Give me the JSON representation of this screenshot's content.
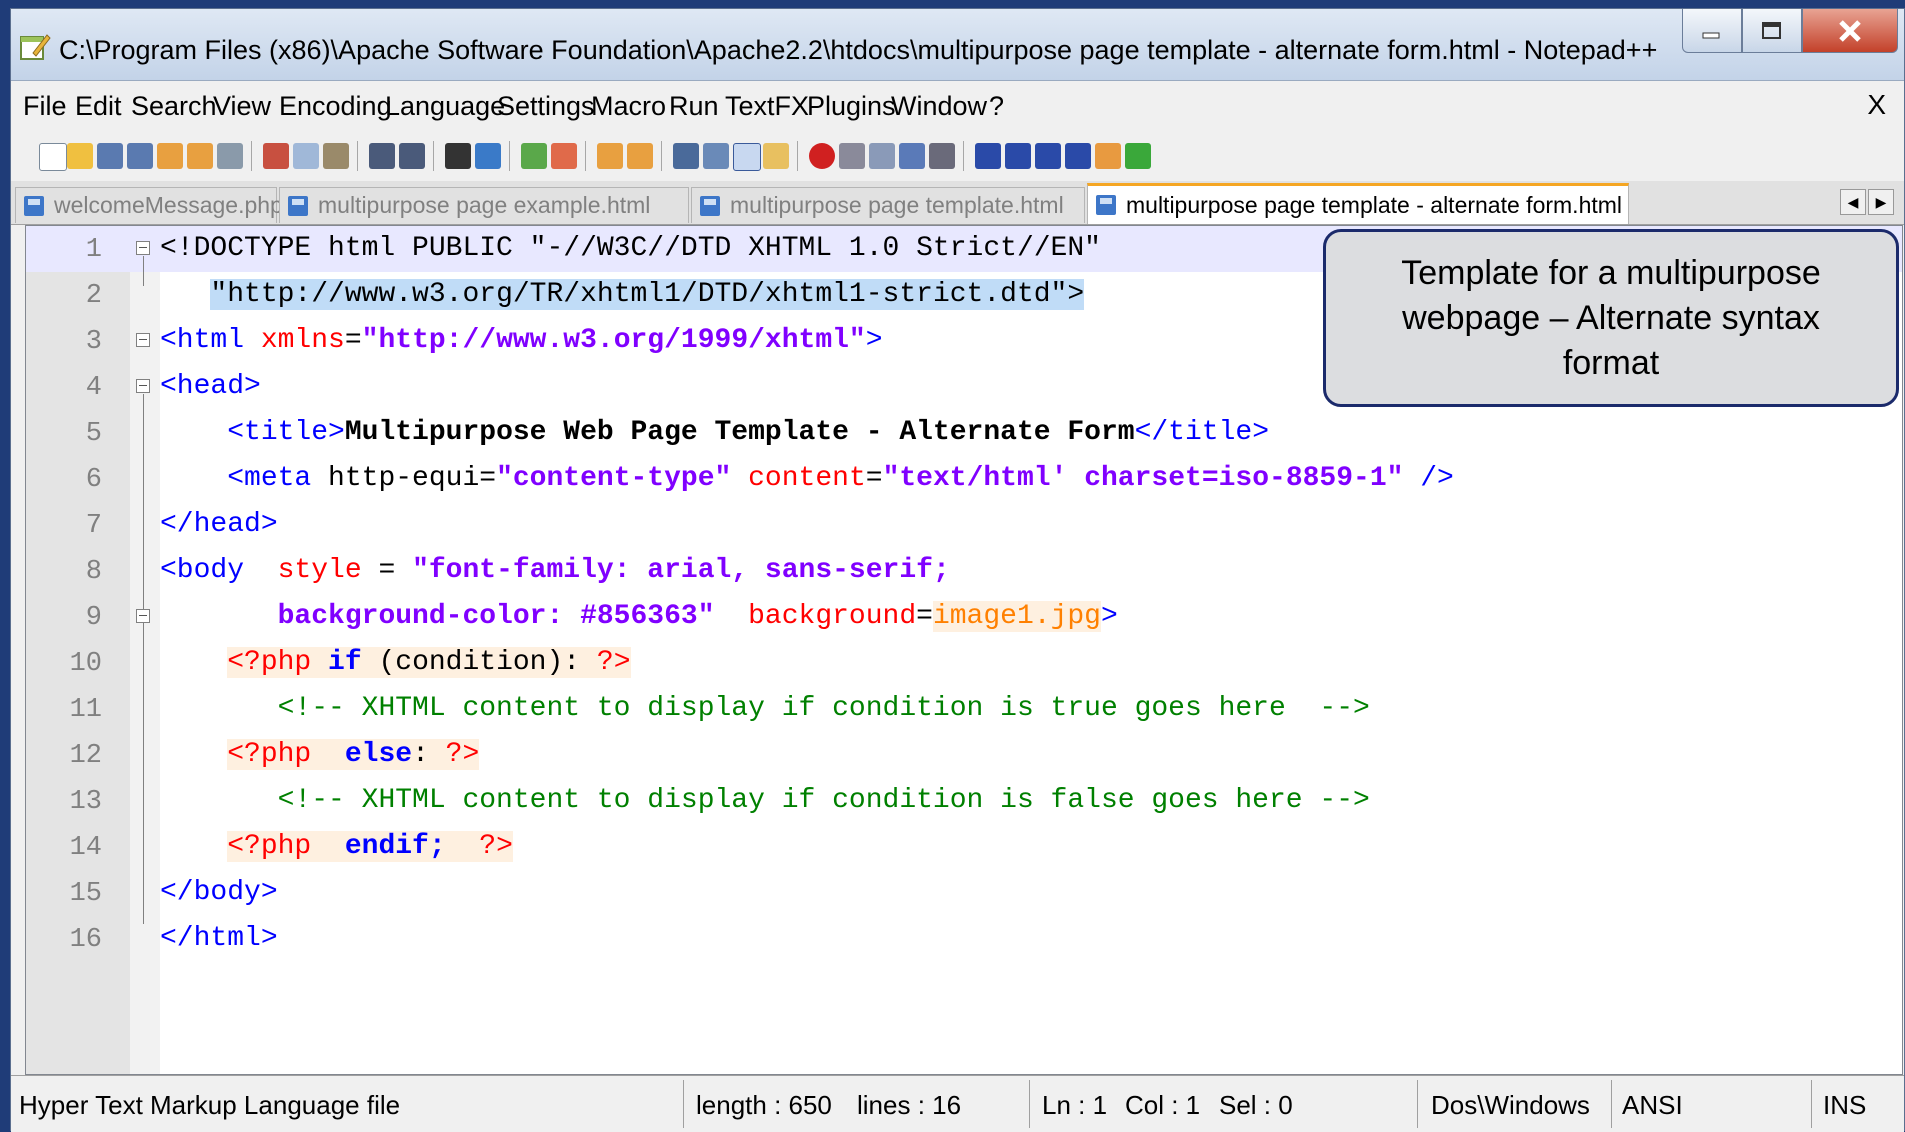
{
  "window": {
    "title": "C:\\Program Files (x86)\\Apache Software Foundation\\Apache2.2\\htdocs\\multipurpose page template - alternate form.html - Notepad++"
  },
  "menu": {
    "items": [
      "File",
      "Edit",
      "Search",
      "View",
      "Encoding",
      "Language",
      "Settings",
      "Macro",
      "Run",
      "TextFX",
      "Plugins",
      "Window",
      "?"
    ],
    "close": "X"
  },
  "tabs": [
    {
      "label": "welcomeMessage.php",
      "active": false
    },
    {
      "label": "multipurpose page example.html",
      "active": false
    },
    {
      "label": "multipurpose page template.html",
      "active": false
    },
    {
      "label": "multipurpose page template - alternate form.html",
      "active": true
    }
  ],
  "editor": {
    "line_numbers": [
      "1",
      "2",
      "3",
      "4",
      "5",
      "6",
      "7",
      "8",
      "9",
      "10",
      "11",
      "12",
      "13",
      "14",
      "15",
      "16"
    ],
    "lines": {
      "l1": [
        "<!DOCTYPE html PUBLIC \"-//W3C//DTD XHTML 1.0 Strict//EN\""
      ],
      "l2": [
        "   ",
        "\"http://www.w3.org/TR/xhtml1/DTD/xhtml1-strict.dtd\"",
        ">"
      ],
      "l3": [
        "<html",
        " xmlns",
        "=",
        "\"http://www.w3.org/1999/xhtml\"",
        ">"
      ],
      "l4": [
        "<head>"
      ],
      "l5": [
        "    ",
        "<title>",
        "Multipurpose Web Page Template - Alternate Form",
        "</title>"
      ],
      "l6": [
        "    ",
        "<meta",
        " http-equi",
        "=",
        "\"content-type\"",
        " content",
        "=",
        "\"text/html' charset=iso-8859-1\"",
        " />"
      ],
      "l7": [
        "</head>"
      ],
      "l8": [
        "<body",
        "  style",
        " = ",
        "\"font-family: arial, sans-serif;"
      ],
      "l9": [
        "       ",
        "background-color: #856363\"",
        "  background",
        "=",
        "image1.jpg",
        ">"
      ],
      "l10": [
        "    ",
        "<?php",
        " ",
        "if",
        " (condition): ",
        "?>"
      ],
      "l11": [
        "       ",
        "<!-- XHTML content to display if condition is true goes here  -->"
      ],
      "l12": [
        "    ",
        "<?php",
        "  ",
        "else",
        ": ",
        "?>"
      ],
      "l13": [
        "       ",
        "<!-- XHTML content to display if condition is false goes here -->"
      ],
      "l14": [
        "    ",
        "<?php",
        "  ",
        "endif;",
        "  ",
        "?>"
      ],
      "l15": [
        "</body>"
      ],
      "l16": [
        "</html>"
      ]
    }
  },
  "callout": {
    "text": "Template for a multipurpose webpage – Alternate syntax format"
  },
  "status": {
    "file_type": "Hyper Text Markup Language file",
    "length": "length : 650",
    "lines": "lines : 16",
    "ln": "Ln : 1",
    "col": "Col : 1",
    "sel": "Sel : 0",
    "eol": "Dos\\Windows",
    "encoding": "ANSI",
    "mode": "INS"
  },
  "toolbar_icons": [
    "new-file-icon",
    "open-file-icon",
    "save-icon",
    "save-all-icon",
    "close-icon",
    "close-all-icon",
    "print-icon",
    "cut-icon",
    "copy-icon",
    "paste-icon",
    "undo-icon",
    "redo-icon",
    "find-icon",
    "replace-icon",
    "zoom-in-icon",
    "zoom-out-icon",
    "sync-v-icon",
    "sync-h-icon",
    "word-wrap-icon",
    "show-all-chars-icon",
    "indent-guide-icon",
    "user-lang-icon",
    "record-macro-icon",
    "stop-macro-icon",
    "play-macro-icon",
    "run-macro-multiple-icon",
    "save-macro-icon",
    "sum-icon",
    "up-icon",
    "down-icon",
    "sigma-icon",
    "plugin-icon",
    "spellcheck-icon"
  ]
}
